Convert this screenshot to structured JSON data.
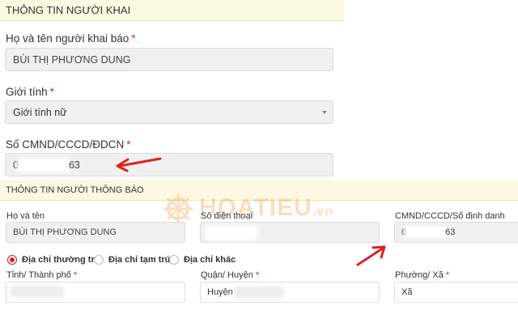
{
  "section1": {
    "title": "THÔNG TIN NGƯỜI KHAI",
    "name_label": "Họ và tên người khai báo",
    "name_value": "BÙI THỊ PHƯƠNG DUNG",
    "gender_label": "Giới tính",
    "gender_value": "Giới tính nữ",
    "id_label": "Số CMND/CCCD/ĐDCN",
    "id_prefix": "0",
    "id_suffix": "63"
  },
  "section2": {
    "title": "THÔNG TIN NGƯỜI THÔNG BÁO",
    "name_label": "Họ và tên",
    "name_value": "BÙI THỊ PHƯƠNG DUNG",
    "phone_label": "Số điện thoại",
    "id_label": "CMND/CCCD/Số định danh",
    "id_prefix": "0",
    "id_suffix": "63",
    "radios": [
      {
        "label": "Địa chỉ thường trú",
        "selected": true
      },
      {
        "label": "Địa chỉ tạm trú",
        "selected": false
      },
      {
        "label": "Địa chỉ khác",
        "selected": false
      }
    ],
    "province_label": "Tỉnh/ Thành phố",
    "district_label": "Quận/ Huyện",
    "district_value": "Huyện",
    "ward_label": "Phường/ Xã",
    "ward_value": "Xã"
  },
  "required_mark": "*",
  "watermark": {
    "brand": "HOATIEU",
    "tld": ".vn",
    "icon": "ship-wheel-icon"
  },
  "colors": {
    "accent_red": "#e02020",
    "header_bg": "#fdf8e1",
    "watermark": "#f08a24",
    "field_bg": "#f0f0f0"
  }
}
